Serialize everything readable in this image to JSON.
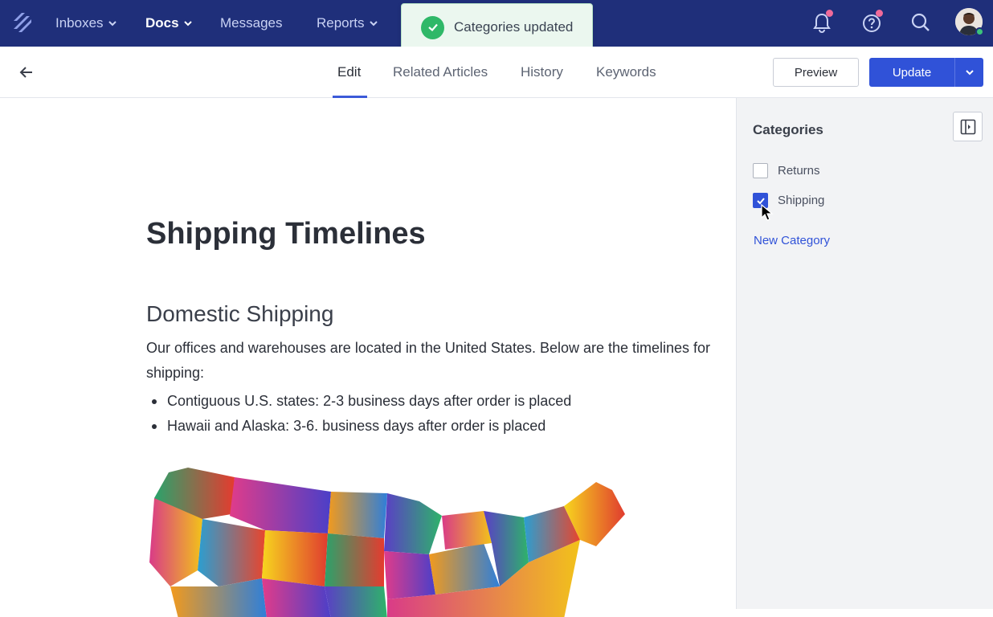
{
  "topbar": {
    "nav": [
      {
        "label": "Inboxes",
        "has_dropdown": true,
        "active": false
      },
      {
        "label": "Docs",
        "has_dropdown": true,
        "active": true
      },
      {
        "label": "Messages",
        "has_dropdown": false,
        "active": false
      },
      {
        "label": "Reports",
        "has_dropdown": true,
        "active": false
      }
    ],
    "icons": [
      "notification-bell-icon",
      "help-icon",
      "search-icon",
      "user-avatar"
    ],
    "colors": {
      "background": "#1f2f7a",
      "notification_dot": "#f06a9a",
      "online_dot": "#3bc37a"
    }
  },
  "toast": {
    "message": "Categories updated",
    "icon": "check-circle-icon",
    "color": "#2fb868"
  },
  "subnav": {
    "tabs": [
      {
        "label": "Edit",
        "active": true
      },
      {
        "label": "Related Articles",
        "active": false
      },
      {
        "label": "History",
        "active": false
      },
      {
        "label": "Keywords",
        "active": false
      }
    ],
    "preview_label": "Preview",
    "update_label": "Update",
    "accent": "#3052d8"
  },
  "article": {
    "title": "Shipping Timelines",
    "section_heading": "Domestic Shipping",
    "paragraph": "Our offices and warehouses are located in the United States. Below are the timelines for shipping:",
    "bullets": [
      "Contiguous U.S. states: 2-3 business days after order is placed",
      "Hawaii and Alaska: 3-6. business days after order is placed"
    ],
    "image": "us-states-map"
  },
  "categories_panel": {
    "title": "Categories",
    "items": [
      {
        "label": "Returns",
        "checked": false
      },
      {
        "label": "Shipping",
        "checked": true
      }
    ],
    "new_category_label": "New Category"
  }
}
